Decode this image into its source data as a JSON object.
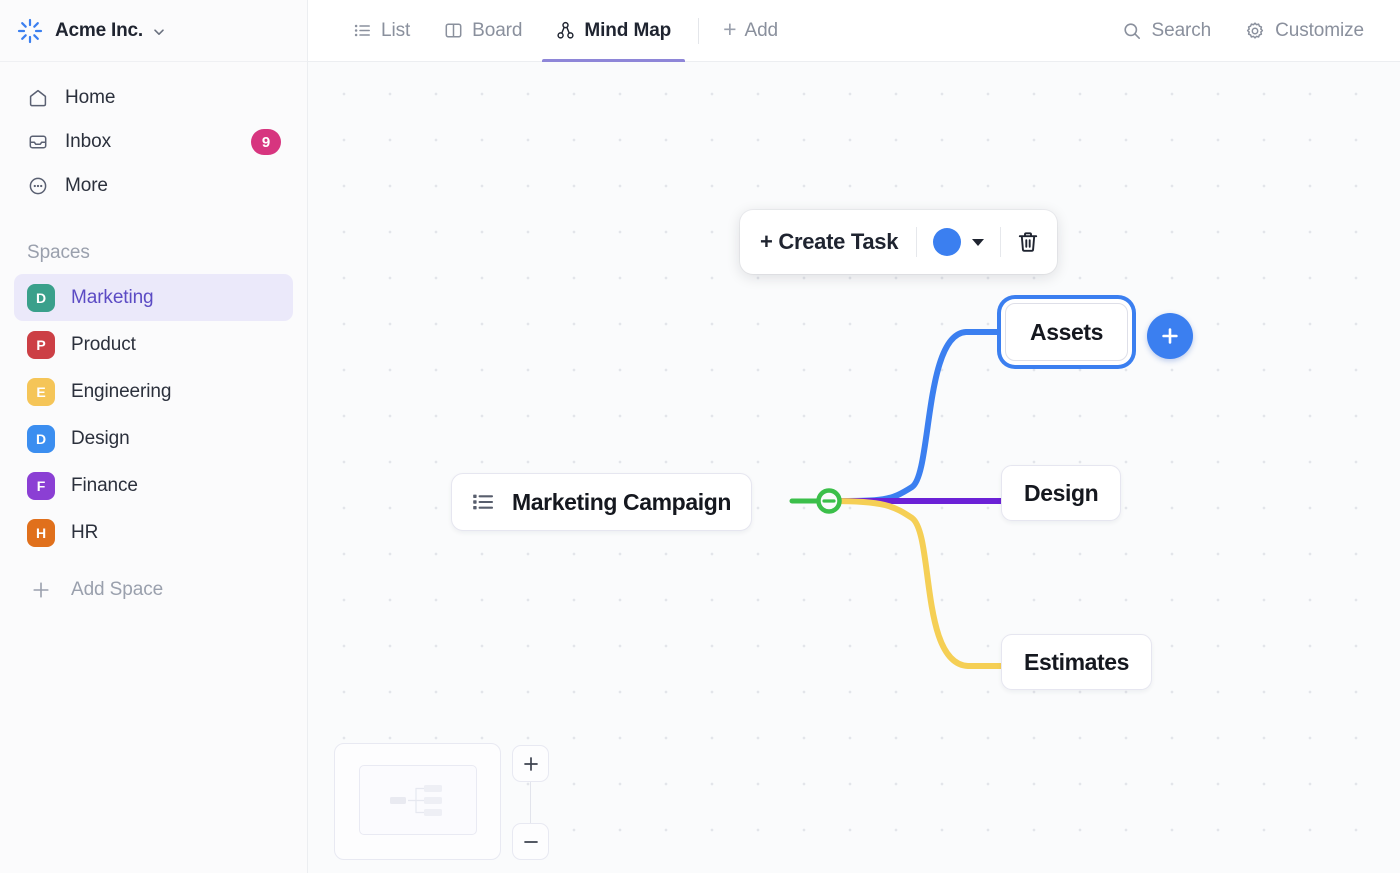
{
  "workspace": {
    "name": "Acme Inc.",
    "logo_icon": "starburst-logo-icon",
    "chevron_icon": "chevron-down-icon",
    "accent_color": "#3b7ff0"
  },
  "sidebar": {
    "nav": [
      {
        "label": "Home",
        "icon": "home-icon"
      },
      {
        "label": "Inbox",
        "icon": "inbox-icon",
        "badge": "9"
      },
      {
        "label": "More",
        "icon": "ellipsis-circle-icon"
      }
    ],
    "spaces_title": "Spaces",
    "spaces": [
      {
        "label": "Marketing",
        "initial": "D",
        "color": "#3aa08b",
        "active": true
      },
      {
        "label": "Product",
        "initial": "P",
        "color": "#cc3f45",
        "active": false
      },
      {
        "label": "Engineering",
        "initial": "E",
        "color": "#f5c558",
        "active": false
      },
      {
        "label": "Design",
        "initial": "D",
        "color": "#3b8ef0",
        "active": false
      },
      {
        "label": "Finance",
        "initial": "F",
        "color": "#8b3fd4",
        "active": false
      },
      {
        "label": "HR",
        "initial": "H",
        "color": "#e0701c",
        "active": false
      }
    ],
    "add_space_label": "Add Space",
    "add_space_icon": "plus-icon"
  },
  "topbar": {
    "tabs": [
      {
        "label": "List",
        "icon": "list-icon",
        "active": false
      },
      {
        "label": "Board",
        "icon": "board-icon",
        "active": false
      },
      {
        "label": "Mind Map",
        "icon": "mindmap-icon",
        "active": true
      }
    ],
    "add_label": "Add",
    "add_icon": "plus-icon",
    "actions": [
      {
        "label": "Search",
        "icon": "search-icon"
      },
      {
        "label": "Customize",
        "icon": "gear-icon"
      }
    ],
    "active_tab_underline_color": "#8e86d8"
  },
  "toolbar": {
    "create_task_label": "+ Create Task",
    "color_swatch": "#3b7ff0",
    "caret_icon": "caret-down-icon",
    "delete_icon": "trash-icon"
  },
  "mindmap": {
    "root": {
      "label": "Marketing Campaign",
      "icon": "list-icon",
      "collapse_toggle": {
        "icon": "minus-circle-icon",
        "color": "#3bbf4a",
        "state": "expanded"
      }
    },
    "children": [
      {
        "label": "Assets",
        "edge_color": "#3b7ff0",
        "selected": true,
        "selection_color": "#3b7ff0"
      },
      {
        "label": "Design",
        "edge_color": "#6b21d6",
        "selected": false
      },
      {
        "label": "Estimates",
        "edge_color": "#f5cf55",
        "selected": false
      }
    ],
    "add_child_button": {
      "icon": "plus-icon",
      "color": "#3b7ff0"
    }
  },
  "canvas_controls": {
    "minimap": "minimap",
    "zoom_in_icon": "plus-icon",
    "zoom_out_icon": "minus-icon"
  }
}
